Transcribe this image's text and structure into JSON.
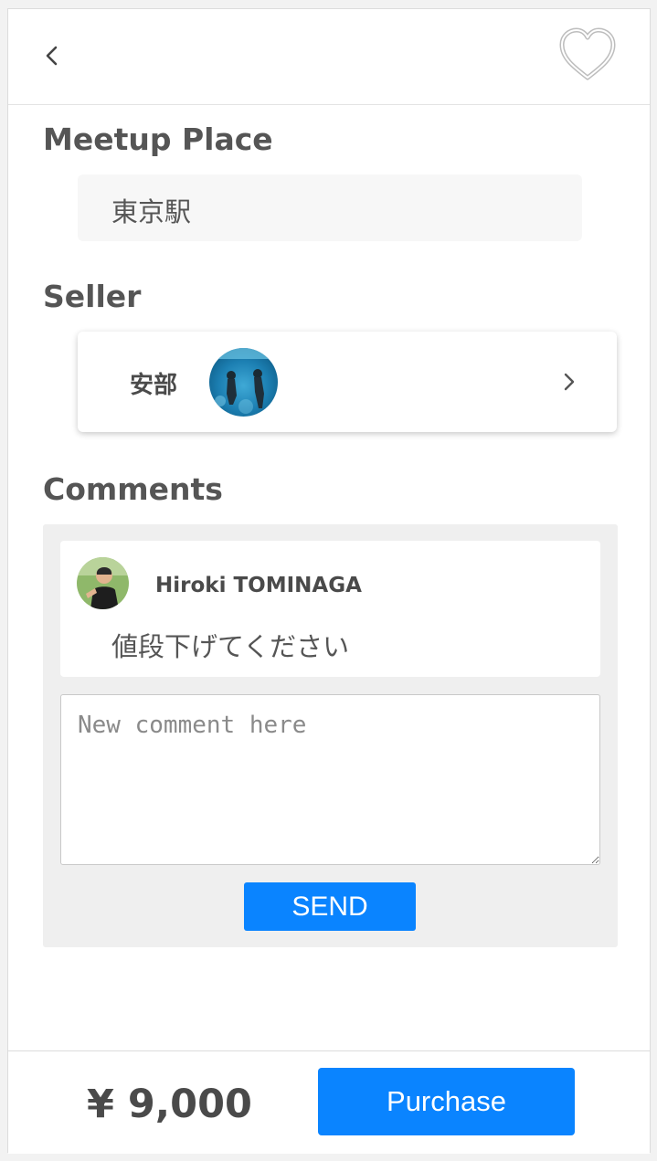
{
  "header": {
    "back_icon": "chevron-left-icon",
    "favorite_icon": "heart-outline-icon"
  },
  "meetup": {
    "title": "Meetup Place",
    "place": "東京駅"
  },
  "seller": {
    "title": "Seller",
    "name": "安部",
    "avatar_icon": "seller-avatar-photo",
    "chevron_icon": "chevron-right-icon"
  },
  "comments": {
    "title": "Comments",
    "items": [
      {
        "author": "Hiroki TOMINAGA",
        "text": "値段下げてください",
        "avatar_icon": "commenter-avatar-photo"
      }
    ],
    "input_placeholder": "New comment here",
    "send_label": "SEND"
  },
  "footer": {
    "price": "¥ 9,000",
    "purchase_label": "Purchase"
  },
  "colors": {
    "accent": "#0a84ff",
    "text": "#4a4a4a",
    "panel": "#efefef"
  }
}
